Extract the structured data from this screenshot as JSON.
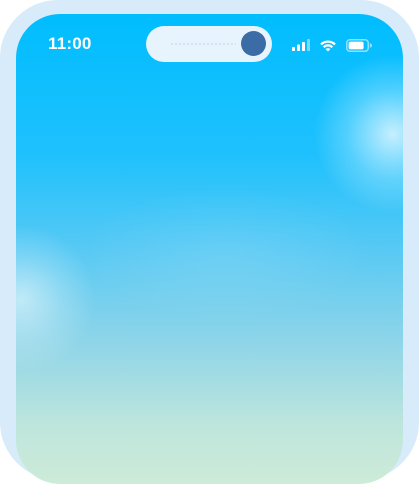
{
  "status_bar": {
    "time": "11:00",
    "icons": [
      "cellular-signal-icon",
      "wifi-icon",
      "battery-icon"
    ]
  },
  "dynamic_island": {
    "camera": "front-camera-icon"
  },
  "colors": {
    "frame": "#d7ebfa",
    "screen_top": "#00bdfe",
    "screen_bottom": "#cdebd8",
    "island": "#e7f4fd",
    "camera": "#3b6ca6",
    "status_text": "#ffffff"
  }
}
